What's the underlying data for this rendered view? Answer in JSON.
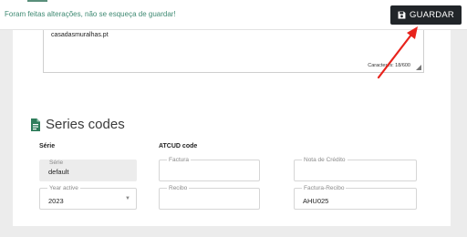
{
  "topbar": {
    "notice": "Foram feitas alterações, não se esqueça de guardar!",
    "save_label": "GUARDAR",
    "notice_color": "#3f8a73",
    "button_color": "#212529"
  },
  "description": {
    "value": "casadasmuralhas.pt",
    "char_count": "Caracteres: 18/600"
  },
  "series_codes": {
    "title": "Series codes",
    "icon": "document-icon",
    "serie_label": "Série",
    "atcud_label": "ATCUD code",
    "serie_field": {
      "label": "Série",
      "value": "default"
    },
    "year_field": {
      "label": "Year active",
      "value": "2023"
    },
    "factura": {
      "label": "Factura",
      "value": ""
    },
    "nota_credito": {
      "label": "Nota de Crédito",
      "value": ""
    },
    "recibo": {
      "label": "Recibo",
      "value": ""
    },
    "factura_recibo": {
      "label": "Factura-Recibo",
      "value": "AHU025"
    }
  },
  "annotation": {
    "arrow_color": "#e8231c"
  }
}
